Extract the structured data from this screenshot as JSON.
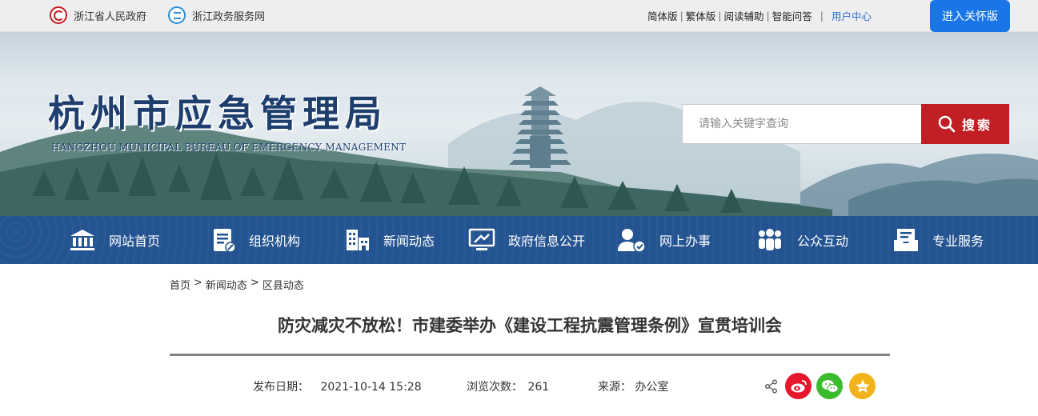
{
  "topbar": {
    "gov_link": "浙江省人民政府",
    "service_link": "浙江政务服务网",
    "simplified": "简体版",
    "traditional": "繁体版",
    "reading_aid": "阅读辅助",
    "smart_qa": "智能问答",
    "user_center": "用户中心",
    "elder_mode": "进入关怀版",
    "sep": "|"
  },
  "banner": {
    "title": "杭州市应急管理局",
    "subtitle": "HANGZHOU MUNICIPAL BUREAU OF EMERGENCY MANAGEMENT"
  },
  "search": {
    "placeholder": "请输入关键字查询",
    "button": "搜索"
  },
  "nav": {
    "items": [
      {
        "label": "网站首页",
        "icon": "bank-icon"
      },
      {
        "label": "组织机构",
        "icon": "document-edit-icon"
      },
      {
        "label": "新闻动态",
        "icon": "building-icon"
      },
      {
        "label": "政府信息公开",
        "icon": "monitor-icon"
      },
      {
        "label": "网上办事",
        "icon": "user-service-icon"
      },
      {
        "label": "公众互动",
        "icon": "people-icon"
      },
      {
        "label": "专业服务",
        "icon": "mail-tray-icon"
      }
    ]
  },
  "breadcrumb": {
    "home": "首页",
    "news": "新闻动态",
    "district": "区县动态",
    "sep": ">"
  },
  "article": {
    "title": "防灾减灾不放松！市建委举办《建设工程抗震管理条例》宣贯培训会",
    "publish_label": "发布日期：",
    "publish_date": "2021-10-14  15:28",
    "views_label": "浏览次数：",
    "views": "261",
    "source_label": "来源：",
    "source": "办公室"
  },
  "share": {
    "icons": [
      "share-icon",
      "weibo-icon",
      "wechat-icon",
      "favorite-icon"
    ],
    "colors": {
      "weibo": "#e6162d",
      "wechat": "#3dbb2f",
      "favorite": "#f2b21b"
    }
  },
  "colors": {
    "nav_bg": "#235391",
    "search_btn": "#c11f24",
    "elder_btn": "#1a76e8",
    "title_text": "#1e3f6e"
  }
}
